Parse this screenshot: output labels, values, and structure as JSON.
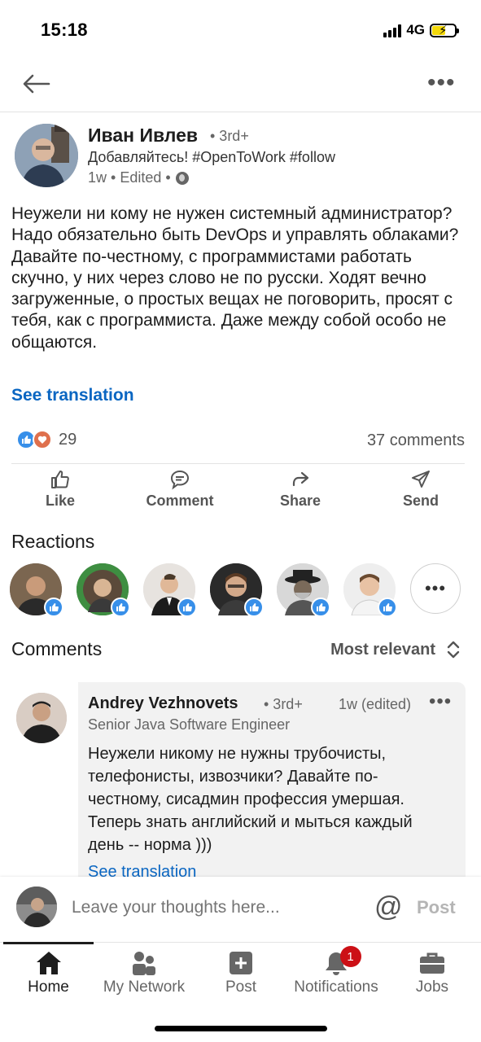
{
  "status": {
    "time": "15:18",
    "network": "4G"
  },
  "post": {
    "author": {
      "name": "Иван Ивлев",
      "degree": "• 3rd+",
      "headline": "Добавляйтесь! #OpenToWork #follow",
      "meta": "1w • Edited •"
    },
    "text": "Неужели ни кому не нужен системный администратор? Надо обязательно быть DevOps и управлять облаками? Давайте по-честному, с программистами работать скучно, у них через слово не по русски. Ходят вечно загруженные, о простых вещах не поговорить, просят с тебя, как с программиста. Даже между собой особо не общаются.",
    "see_translation": "See translation",
    "reaction_count": "29",
    "comment_count": "37 comments"
  },
  "actions": {
    "like": "Like",
    "comment": "Comment",
    "share": "Share",
    "send": "Send"
  },
  "reactions": {
    "title": "Reactions"
  },
  "comments": {
    "title": "Comments",
    "sort": "Most relevant",
    "items": [
      {
        "name": "Andrey Vezhnovets",
        "degree": "• 3rd+",
        "time": "1w (edited)",
        "headline": "Senior Java Software Engineer",
        "text": "Неужели никому не нужны трубочисты, телефонисты, извозчики? Давайте по-честному,   сисадмин профессия умершая. Теперь знать английский и мыться каждый день -- норма )))",
        "see_translation": "See translation"
      }
    ]
  },
  "composer": {
    "placeholder": "Leave your thoughts here...",
    "post": "Post",
    "at": "@"
  },
  "tabs": [
    {
      "label": "Home"
    },
    {
      "label": "My Network"
    },
    {
      "label": "Post"
    },
    {
      "label": "Notifications",
      "badge": "1"
    },
    {
      "label": "Jobs"
    }
  ],
  "colors": {
    "link": "#0a66c2",
    "like": "#378fe9",
    "love": "#df704d",
    "badge": "#cc1016"
  }
}
